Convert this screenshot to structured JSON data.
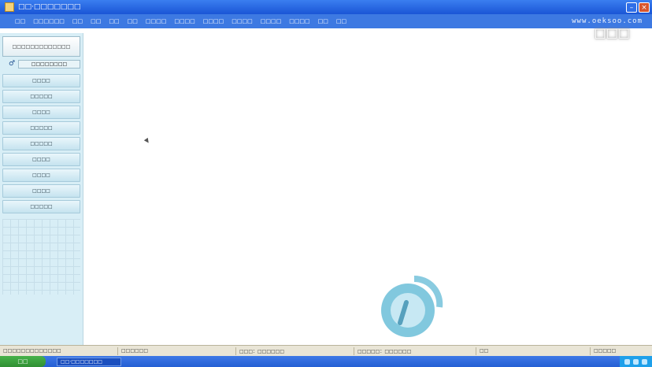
{
  "window": {
    "title": "□□·□□□□□□□"
  },
  "menu": {
    "items": [
      "□□",
      "□□□□□□",
      "□□",
      "□□",
      "□□",
      "□□",
      "□□□□",
      "□□□□",
      "□□□□",
      "□□□□",
      "□□□□",
      "□□□□",
      "□□",
      "□□"
    ]
  },
  "watermark": {
    "url": "www.oeksoo.com",
    "label": "□□□"
  },
  "sidebar": {
    "header": "□□□□□□□□□□□□□",
    "user": "□□□□□□□□",
    "items": [
      "□□□□",
      "□□□□□",
      "□□□□",
      "□□□□□",
      "□□□□□",
      "□□□□",
      "□□□□",
      "□□□□",
      "□□□□□"
    ]
  },
  "status": {
    "segments": [
      "□□□□□□□□□□□□□",
      "□□□□□□",
      "□□□：□□□□□□",
      "□□□□□：□□□□□□",
      "□□",
      "□□□□□"
    ]
  },
  "taskbar": {
    "start": "□□",
    "task": "□□·□□□□□□□"
  },
  "colors": {
    "title_bar": "#1a55d6",
    "menu_bar": "#3d79e2",
    "sidebar": "#d8eef6",
    "logo": "#57b5d3"
  }
}
